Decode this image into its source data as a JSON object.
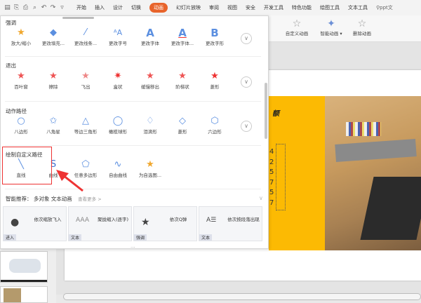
{
  "quick_access": [
    "save-icon",
    "paste-icon",
    "print-icon",
    "preview-icon",
    "undo-icon",
    "redo-icon",
    "customize-icon"
  ],
  "tabs": [
    "开始",
    "插入",
    "设计",
    "切换",
    "动画",
    "幻灯片放映",
    "审阅",
    "视图",
    "安全",
    "开发工具",
    "特色功能",
    "绘图工具",
    "文本工具"
  ],
  "active_tab": "动画",
  "search": "ppt文",
  "ribbon": {
    "custom_animation": "自定义动画",
    "smart_animation": "智能动画",
    "delete_animation": "删除动画"
  },
  "panel": {
    "sections": [
      {
        "label": "强调",
        "items": [
          "放大/缩小",
          "更改填充...",
          "更改线条...",
          "更改字号",
          "更改字体",
          "更改字体...",
          "更改字形"
        ]
      },
      {
        "label": "退出",
        "items": [
          "百叶窗",
          "擦除",
          "飞出",
          "盒状",
          "缓慢移出",
          "阶梯状",
          "菱形"
        ]
      },
      {
        "label": "动作路径",
        "items": [
          "八边形",
          "八角星",
          "等边三角形",
          "橄榄球形",
          "泪滴形",
          "菱形",
          "六边形"
        ]
      },
      {
        "label": "绘制自定义路径",
        "items": [
          "直线",
          "曲线",
          "任意多边形",
          "自由曲线",
          "为自选图..."
        ]
      }
    ],
    "recommend": {
      "label": "智能推荐：",
      "objects": "多对象 文本动画",
      "more": "查看更多 >",
      "cards": [
        {
          "title": "依次缩放飞入",
          "tag": "进入"
        },
        {
          "title": "聚拢缩入(逐字)",
          "tag": "文本"
        },
        {
          "title": "依次Q弹",
          "tag": "强调"
        },
        {
          "title": "依次按段落出现",
          "tag": "文本"
        }
      ]
    }
  },
  "slide": {
    "title": "额",
    "numbers": [
      "4",
      "2",
      "5",
      "7",
      "5",
      "7"
    ],
    "accent": "#fcba03"
  },
  "colors": {
    "active_tab": "#e8642b",
    "highlight_box": "#e33333"
  }
}
